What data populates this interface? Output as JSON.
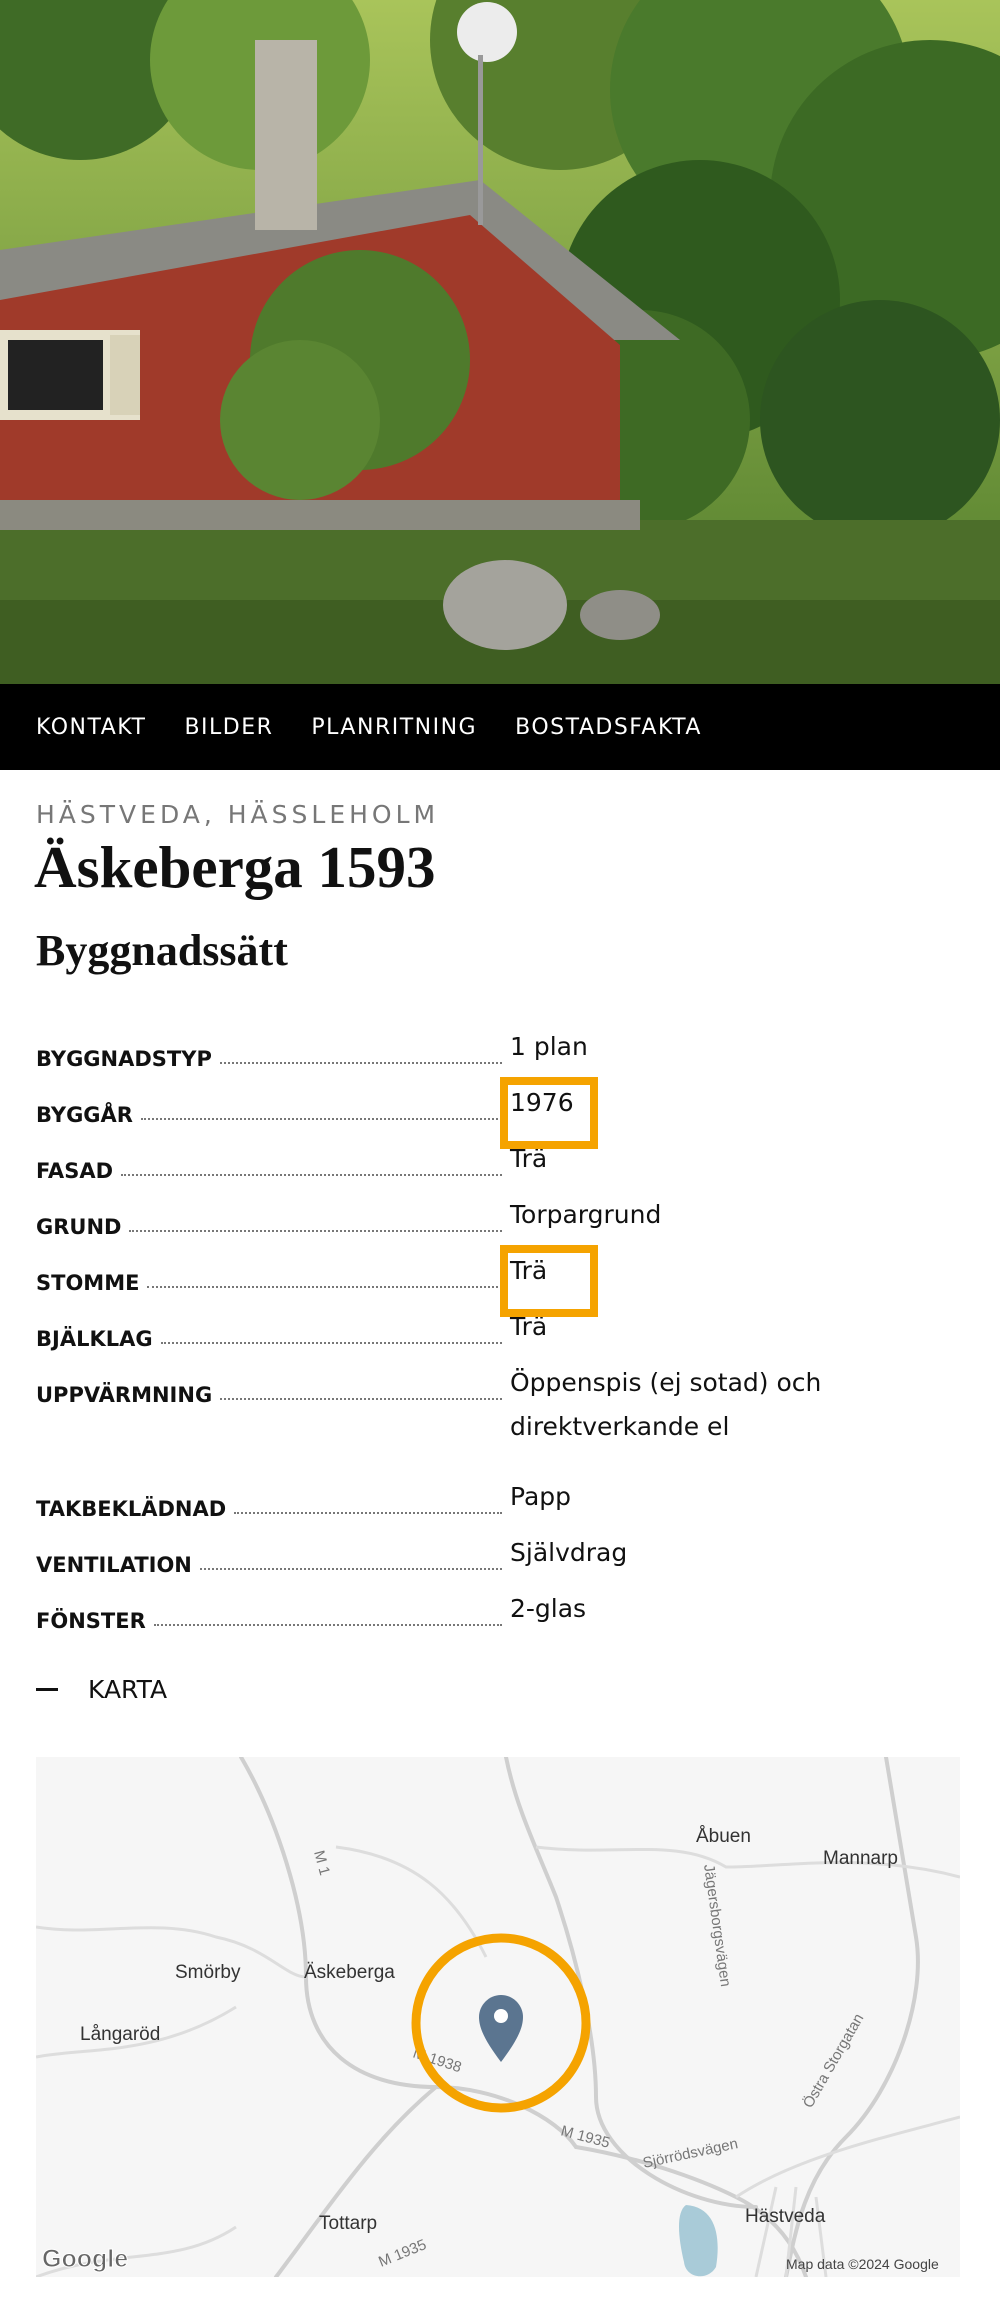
{
  "nav": {
    "items": [
      "KONTAKT",
      "BILDER",
      "PLANRITNING",
      "BOSTADSFAKTA"
    ]
  },
  "header": {
    "location": "HÄSTVEDA, HÄSSLEHOLM",
    "title": "Äskeberga 1593",
    "section_title": "Byggnadssätt"
  },
  "facts": [
    {
      "label": "BYGGNADSTYP",
      "value": "1 plan"
    },
    {
      "label": "BYGGÅR",
      "value": "1976"
    },
    {
      "label": "FASAD",
      "value": "Trä"
    },
    {
      "label": "GRUND",
      "value": "Torpargrund"
    },
    {
      "label": "STOMME",
      "value": "Trä"
    },
    {
      "label": "BJÄLKLAG",
      "value": "Trä"
    },
    {
      "label": "UPPVÄRMNING",
      "value": "Öppenspis (ej sotad) och direktverkande el"
    },
    {
      "label": "TAKBEKLÄDNAD",
      "value": "Papp"
    },
    {
      "label": "VENTILATION",
      "value": "Självdrag"
    },
    {
      "label": "FÖNSTER",
      "value": "2-glas"
    }
  ],
  "map_toggle": {
    "label": "KARTA"
  },
  "map": {
    "places": [
      "Åbuen",
      "Mannarp",
      "Smörby",
      "Äskeberga",
      "Långaröd",
      "Tottarp",
      "Hästveda"
    ],
    "roads": [
      "M 1",
      "Jägersborgsvägen",
      "M 1938",
      "M 1935",
      "Sjörrödsvägen",
      "Östra Storgatan",
      "M 1935"
    ],
    "logo": "Google",
    "attribution": "Map data ©2024 Google"
  },
  "colors": {
    "highlight": "#f5a300",
    "nav_bg": "#000000",
    "pin": "#5b7590"
  }
}
